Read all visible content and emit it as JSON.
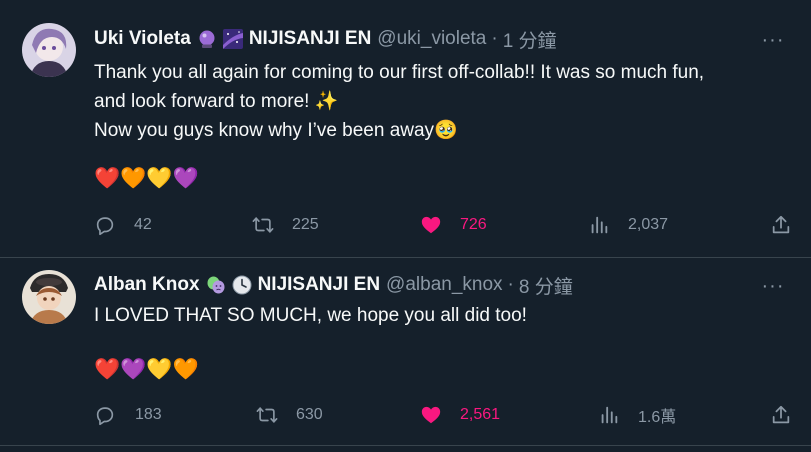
{
  "tweets": [
    {
      "display_name": "Uki Violeta",
      "badges": [
        "crystal-ball-emoji",
        "milky-way-emoji"
      ],
      "affiliation": "NIJISANJI EN",
      "handle": "@uki_violeta",
      "separator": "·",
      "time": "1 分鐘",
      "text_lines": [
        "Thank you all again for coming to our first off-collab!! It was so much fun,",
        "and look forward to more! ✨",
        "Now you guys know why I’ve been away🥹"
      ],
      "hearts": "❤️🧡💛💜",
      "replies": "42",
      "retweets": "225",
      "likes": "726",
      "views": "2,037",
      "liked": true
    },
    {
      "display_name": "Alban Knox",
      "badges": [
        "performing-arts-emoji",
        "clock-emoji"
      ],
      "affiliation": "NIJISANJI EN",
      "handle": "@alban_knox",
      "separator": "·",
      "time": "8 分鐘",
      "text_lines": [
        "I LOVED THAT SO MUCH, we hope you all did too!"
      ],
      "hearts": "❤️💜💛🧡",
      "replies": "183",
      "retweets": "630",
      "likes": "2,561",
      "views": "1.6萬",
      "liked": true
    }
  ],
  "more_label": "···",
  "colors": {
    "background": "#15202b",
    "text_primary": "#f7f9f9",
    "text_secondary": "#8b98a5",
    "like": "#f91880",
    "divider": "#38444d"
  }
}
